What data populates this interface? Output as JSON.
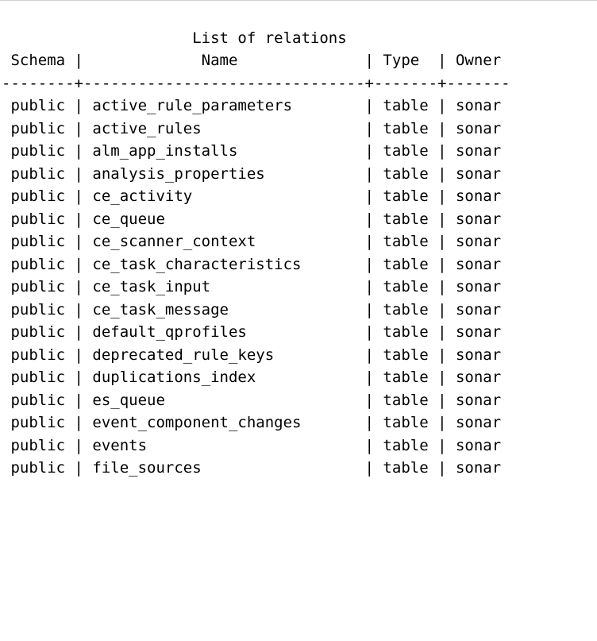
{
  "title": "List of relations",
  "columns": [
    "Schema",
    "Name",
    "Type",
    "Owner"
  ],
  "widths": {
    "schema": 8,
    "name": 30,
    "type": 7,
    "owner": 7
  },
  "titleLine": "                     List of relations",
  "headerLine": " Schema |             Name              | Type  | Owner ",
  "separatorLine": "--------+-------------------------------+-------+-------",
  "rows": [
    {
      "schema": "public",
      "name": "active_rule_parameters",
      "type": "table",
      "owner": "sonar"
    },
    {
      "schema": "public",
      "name": "active_rules",
      "type": "table",
      "owner": "sonar"
    },
    {
      "schema": "public",
      "name": "alm_app_installs",
      "type": "table",
      "owner": "sonar"
    },
    {
      "schema": "public",
      "name": "analysis_properties",
      "type": "table",
      "owner": "sonar"
    },
    {
      "schema": "public",
      "name": "ce_activity",
      "type": "table",
      "owner": "sonar"
    },
    {
      "schema": "public",
      "name": "ce_queue",
      "type": "table",
      "owner": "sonar"
    },
    {
      "schema": "public",
      "name": "ce_scanner_context",
      "type": "table",
      "owner": "sonar"
    },
    {
      "schema": "public",
      "name": "ce_task_characteristics",
      "type": "table",
      "owner": "sonar"
    },
    {
      "schema": "public",
      "name": "ce_task_input",
      "type": "table",
      "owner": "sonar"
    },
    {
      "schema": "public",
      "name": "ce_task_message",
      "type": "table",
      "owner": "sonar"
    },
    {
      "schema": "public",
      "name": "default_qprofiles",
      "type": "table",
      "owner": "sonar"
    },
    {
      "schema": "public",
      "name": "deprecated_rule_keys",
      "type": "table",
      "owner": "sonar"
    },
    {
      "schema": "public",
      "name": "duplications_index",
      "type": "table",
      "owner": "sonar"
    },
    {
      "schema": "public",
      "name": "es_queue",
      "type": "table",
      "owner": "sonar"
    },
    {
      "schema": "public",
      "name": "event_component_changes",
      "type": "table",
      "owner": "sonar"
    },
    {
      "schema": "public",
      "name": "events",
      "type": "table",
      "owner": "sonar"
    },
    {
      "schema": "public",
      "name": "file_sources",
      "type": "table",
      "owner": "sonar"
    }
  ]
}
